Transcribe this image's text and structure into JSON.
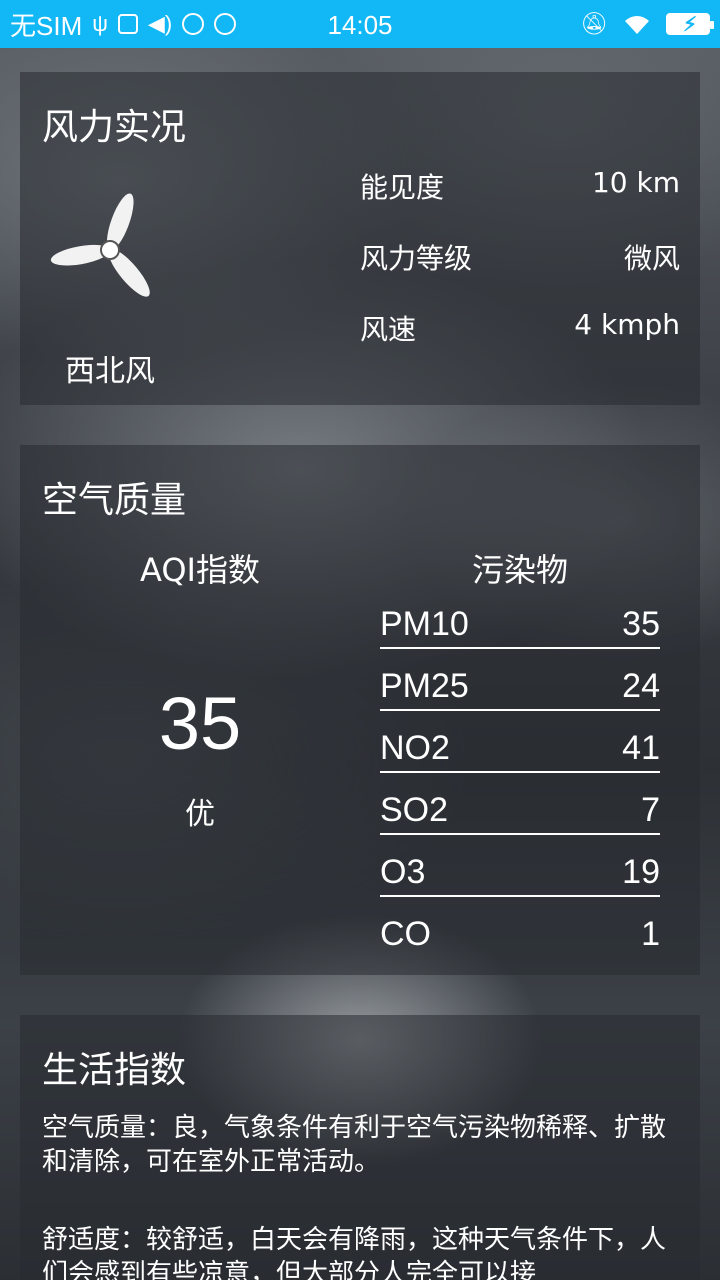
{
  "status_bar": {
    "carrier": "无SIM",
    "time": "14:05"
  },
  "wind": {
    "title": "风力实况",
    "direction": "西北风",
    "rows": [
      {
        "label": "能见度",
        "value": "10 km"
      },
      {
        "label": "风力等级",
        "value": "微风"
      },
      {
        "label": "风速",
        "value": "4 kmph"
      }
    ]
  },
  "air": {
    "title": "空气质量",
    "aqi_heading": "AQI指数",
    "aqi_value": "35",
    "aqi_level": "优",
    "pollutant_heading": "污染物",
    "pollutants": [
      {
        "name": "PM10",
        "value": "35"
      },
      {
        "name": "PM25",
        "value": "24"
      },
      {
        "name": "NO2",
        "value": "41"
      },
      {
        "name": "SO2",
        "value": "7"
      },
      {
        "name": "O3",
        "value": "19"
      },
      {
        "name": "CO",
        "value": "1"
      }
    ]
  },
  "life": {
    "title": "生活指数",
    "items": [
      "空气质量：良，气象条件有利于空气污染物稀释、扩散和清除，可在室外正常活动。",
      "舒适度：较舒适，白天会有降雨，这种天气条件下，人们会感到有些凉意，但大部分人完全可以接"
    ]
  },
  "colors": {
    "status_bar": "#12b7f5",
    "card_bg": "rgba(40,44,50,0.55)",
    "text": "#ffffff"
  }
}
